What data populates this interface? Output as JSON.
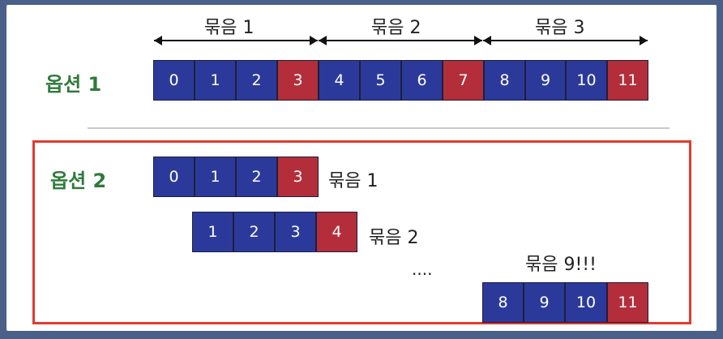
{
  "option1": {
    "label": "옵션 1",
    "groups": [
      "묶음 1",
      "묶음 2",
      "묶음 3"
    ],
    "cells": [
      "0",
      "1",
      "2",
      "3",
      "4",
      "5",
      "6",
      "7",
      "8",
      "9",
      "10",
      "11"
    ]
  },
  "option2": {
    "label": "옵션 2",
    "row1": {
      "cells": [
        "0",
        "1",
        "2",
        "3"
      ],
      "label": "묶음 1"
    },
    "row2": {
      "cells": [
        "1",
        "2",
        "3",
        "4"
      ],
      "label": "묶음 2"
    },
    "ellipsis": "....",
    "row3": {
      "cells": [
        "8",
        "9",
        "10",
        "11"
      ],
      "label": "묶음 9!!!"
    }
  },
  "colors": {
    "blue": "#2b3a9a",
    "red": "#b32e3a",
    "green_label": "#2f7a3a",
    "highlight_box": "#e23a2f"
  }
}
